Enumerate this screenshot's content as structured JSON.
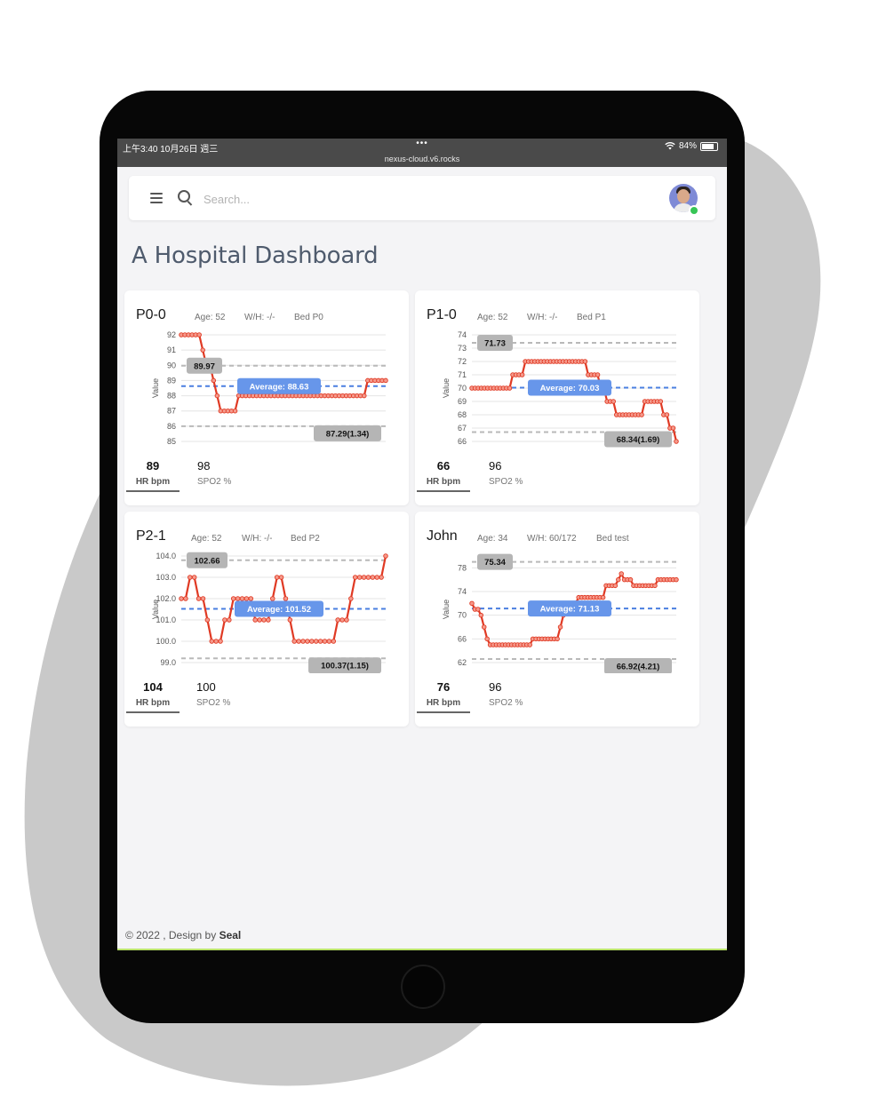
{
  "status_bar": {
    "time_date": "上午3:40   10月26日 週三",
    "dots": "•••",
    "url": "nexus-cloud.v6.rocks",
    "battery": "84%"
  },
  "search": {
    "placeholder": "Search..."
  },
  "page": {
    "title": "A Hospital Dashboard"
  },
  "footer": {
    "prefix": "© 2022 , Design by ",
    "brand": "Seal"
  },
  "colors": {
    "series_line": "#e03a24",
    "average_line": "#4a7fe0",
    "ref_line": "#b9b9b9",
    "average_label_bg": "#6796ea",
    "ref_label_bg": "#b5b5b5"
  },
  "patients": [
    {
      "name": "P0-0",
      "age": "Age: 52",
      "wh": "W/H: -/-",
      "bed": "Bed P0",
      "hr": "89",
      "hr_label": "HR bpm",
      "spo2": "98",
      "spo2_label": "SPO2 %"
    },
    {
      "name": "P1-0",
      "age": "Age: 52",
      "wh": "W/H: -/-",
      "bed": "Bed P1",
      "hr": "66",
      "hr_label": "HR bpm",
      "spo2": "96",
      "spo2_label": "SPO2 %"
    },
    {
      "name": "P2-1",
      "age": "Age: 52",
      "wh": "W/H: -/-",
      "bed": "Bed P2",
      "hr": "104",
      "hr_label": "HR bpm",
      "spo2": "100",
      "spo2_label": "SPO2 %"
    },
    {
      "name": "John",
      "age": "Age: 34",
      "wh": "W/H: 60/172",
      "bed": "Bed test",
      "hr": "76",
      "hr_label": "HR bpm",
      "spo2": "96",
      "spo2_label": "SPO2 %"
    }
  ],
  "chart_data": [
    {
      "type": "line",
      "ylabel": "Value",
      "yticks": [
        "92",
        "91",
        "90",
        "89",
        "88",
        "87",
        "86",
        "85"
      ],
      "ylim": [
        85,
        92
      ],
      "grid": true,
      "series": [
        {
          "values": [
            92,
            92,
            92,
            92,
            92,
            92,
            91,
            90,
            90,
            89,
            88,
            87,
            87,
            87,
            87,
            87,
            88,
            88,
            88,
            88,
            88,
            88,
            88,
            88,
            88,
            88,
            88,
            88,
            88,
            88,
            88,
            88,
            88,
            88,
            88,
            88,
            88,
            88,
            88,
            88,
            88,
            88,
            88,
            88,
            88,
            88,
            88,
            88,
            88,
            88,
            88,
            88,
            89,
            89,
            89,
            89,
            89,
            89
          ]
        }
      ],
      "max": 89.97,
      "max_label": "89.97",
      "avg": 88.63,
      "avg_label": "Average: 88.63",
      "min": 86.0,
      "min_label": "87.29(1.34)"
    },
    {
      "type": "line",
      "ylabel": "Value",
      "yticks": [
        "74",
        "73",
        "72",
        "71",
        "70",
        "69",
        "68",
        "67",
        "66"
      ],
      "ylim": [
        66,
        74
      ],
      "grid": true,
      "series": [
        {
          "values": [
            70,
            70,
            70,
            70,
            70,
            70,
            70,
            70,
            70,
            70,
            70,
            70,
            70,
            71,
            71,
            71,
            71,
            72,
            72,
            72,
            72,
            72,
            72,
            72,
            72,
            72,
            72,
            72,
            72,
            72,
            72,
            72,
            72,
            72,
            72,
            72,
            72,
            71,
            71,
            71,
            71,
            70,
            70,
            69,
            69,
            69,
            68,
            68,
            68,
            68,
            68,
            68,
            68,
            68,
            68,
            69,
            69,
            69,
            69,
            69,
            69,
            68,
            68,
            67,
            67,
            66
          ]
        }
      ],
      "max": 73.4,
      "max_label": "71.73",
      "avg": 70.03,
      "avg_label": "Average: 70.03",
      "min": 66.7,
      "min_label": "68.34(1.69)"
    },
    {
      "type": "line",
      "ylabel": "Value",
      "yticks": [
        "104.0",
        "103.0",
        "102.0",
        "101.0",
        "100.0",
        "99.0"
      ],
      "ylim": [
        99,
        104
      ],
      "grid": true,
      "series": [
        {
          "values": [
            102,
            102,
            103,
            103,
            102,
            102,
            101,
            100,
            100,
            100,
            101,
            101,
            102,
            102,
            102,
            102,
            102,
            101,
            101,
            101,
            101,
            102,
            103,
            103,
            102,
            101,
            100,
            100,
            100,
            100,
            100,
            100,
            100,
            100,
            100,
            100,
            101,
            101,
            101,
            102,
            103,
            103,
            103,
            103,
            103,
            103,
            103,
            104
          ]
        }
      ],
      "max": 103.8,
      "max_label": "102.66",
      "avg": 101.52,
      "avg_label": "Average: 101.52",
      "min": 99.2,
      "min_label": "100.37(1.15)"
    },
    {
      "type": "line",
      "ylabel": "Value",
      "yticks": [
        "78",
        "74",
        "70",
        "66",
        "62"
      ],
      "ylim": [
        62,
        80
      ],
      "grid": true,
      "series": [
        {
          "values": [
            72,
            71,
            71,
            70,
            68,
            66,
            65,
            65,
            65,
            65,
            65,
            65,
            65,
            65,
            65,
            65,
            65,
            65,
            65,
            65,
            66,
            66,
            66,
            66,
            66,
            66,
            66,
            66,
            66,
            68,
            70,
            72,
            72,
            72,
            72,
            73,
            73,
            73,
            73,
            73,
            73,
            73,
            73,
            73,
            75,
            75,
            75,
            75,
            76,
            77,
            76,
            76,
            76,
            75,
            75,
            75,
            75,
            75,
            75,
            75,
            75,
            76,
            76,
            76,
            76,
            76,
            76,
            76
          ]
        }
      ],
      "max": 79.0,
      "max_label": "75.34",
      "avg": 71.13,
      "avg_label": "Average: 71.13",
      "min": 62.6,
      "min_label": "66.92(4.21)"
    }
  ]
}
